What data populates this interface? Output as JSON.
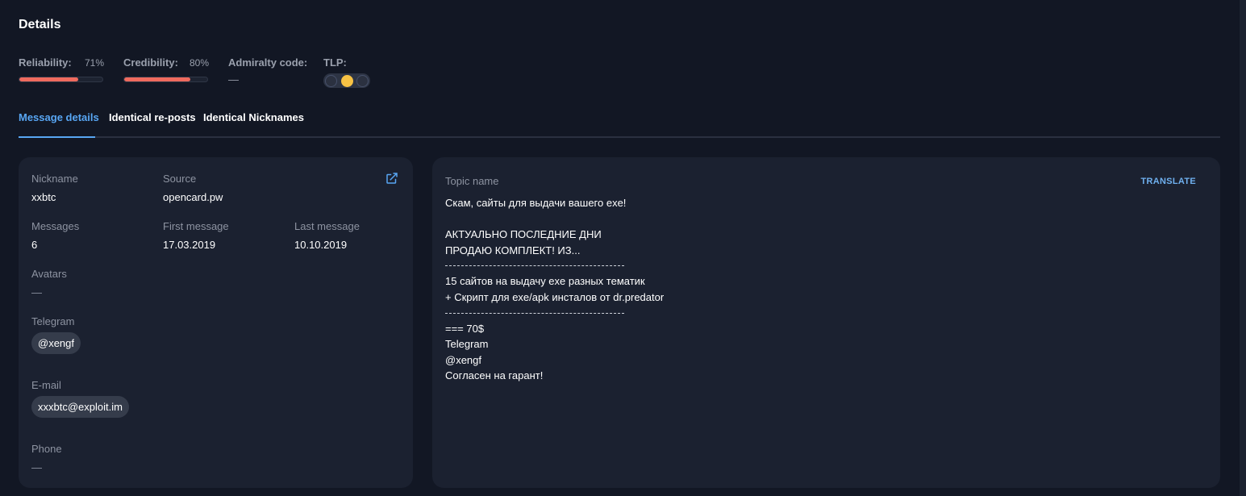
{
  "title": "Details",
  "metrics": {
    "reliability": {
      "label": "Reliability:",
      "value_text": "71%",
      "value": 71
    },
    "credibility": {
      "label": "Credibility:",
      "value_text": "80%",
      "value": 80
    },
    "admiralty": {
      "label": "Admiralty code:",
      "value": "—"
    },
    "tlp": {
      "label": "TLP:",
      "active": "amber"
    }
  },
  "tabs": [
    {
      "label": "Message details",
      "active": true
    },
    {
      "label": "Identical re-posts",
      "active": false
    },
    {
      "label": "Identical Nicknames",
      "active": false
    }
  ],
  "profile": {
    "nickname_label": "Nickname",
    "nickname": "xxbtc",
    "source_label": "Source",
    "source": "opencard.pw",
    "messages_label": "Messages",
    "messages": "6",
    "first_message_label": "First message",
    "first_message": "17.03.2019",
    "last_message_label": "Last message",
    "last_message": "10.10.2019",
    "avatars_label": "Avatars",
    "avatars": "—",
    "telegram_label": "Telegram",
    "telegram": "@xengf",
    "email_label": "E-mail",
    "email": "xxxbtc@exploit.im",
    "phone_label": "Phone",
    "phone": "—",
    "external_link_icon": "external-link-icon"
  },
  "topic": {
    "label": "Topic name",
    "translate_label": "TRANSLATE",
    "lines": [
      "Скам, сайты для выдачи вашего exe!",
      "",
      "АКТУАЛЬНО ПОСЛЕДНИЕ ДНИ",
      "ПРОДАЮ КОМПЛЕКТ! ИЗ...",
      "---",
      "15 сайтов на выдачу exe разных тематик",
      "+ Скрипт для exe/apk инсталов от dr.predator",
      "---",
      "=== 70$",
      "Telegram",
      "@xengf",
      "Согласен на гарант!"
    ]
  },
  "colors": {
    "background": "#121724",
    "card": "#1b2130",
    "accent": "#58a6f3",
    "bar_fill": "#ef6a5e",
    "tlp_amber": "#f7c244"
  }
}
